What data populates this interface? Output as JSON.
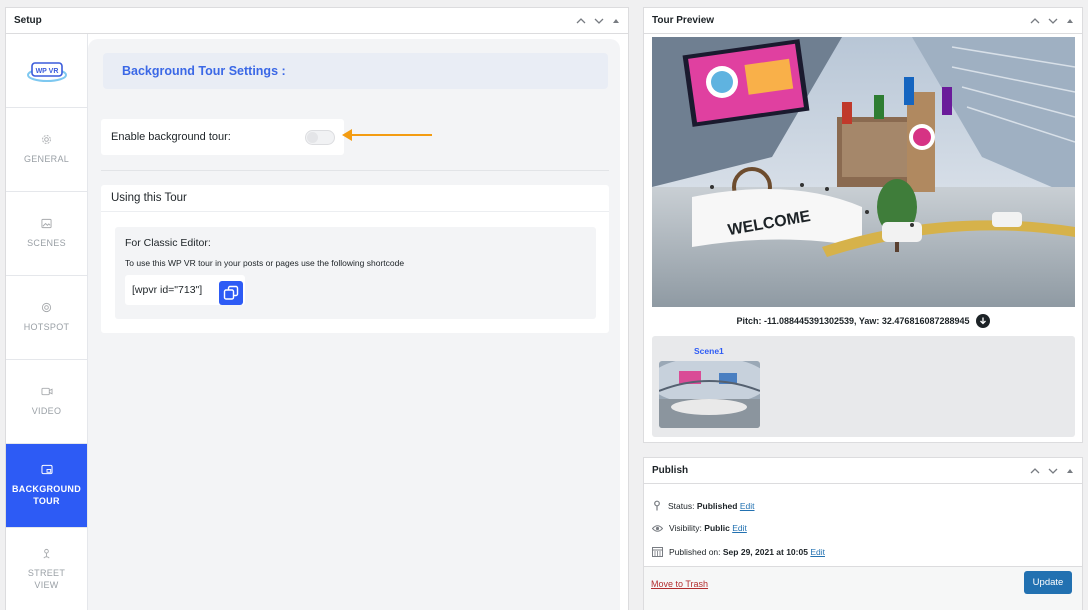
{
  "setup_panel": {
    "title": "Setup",
    "logo_text": "WP VR",
    "nav": [
      {
        "label": "GENERAL",
        "icon": "gear-icon"
      },
      {
        "label": "SCENES",
        "icon": "image-icon"
      },
      {
        "label": "HOTSPOT",
        "icon": "target-icon"
      },
      {
        "label": "VIDEO",
        "icon": "video-icon"
      },
      {
        "label": "BACKGROUND TOUR",
        "icon": "background-icon",
        "active": true
      },
      {
        "label": "STREET VIEW",
        "icon": "pegman-icon"
      }
    ],
    "section_heading": "Background Tour Settings :",
    "enable_label": "Enable background tour:",
    "enable_value": false,
    "using_title": "Using this Tour",
    "classic_title": "For Classic Editor:",
    "classic_desc": "To use this WP VR tour in your posts or pages use the following shortcode",
    "shortcode": "[wpvr id=\"713\"]"
  },
  "preview_panel": {
    "title": "Tour Preview",
    "pitch_yaw": "Pitch: -11.088445391302539, Yaw: 32.476816087288945",
    "welcome_sign": "WELCOME",
    "scene_label": "Scene1"
  },
  "publish_panel": {
    "title": "Publish",
    "status_label": "Status:",
    "status_value": "Published",
    "visibility_label": "Visibility:",
    "visibility_value": "Public",
    "published_label": "Published on:",
    "published_value": "Sep 29, 2021 at 10:05",
    "edit_link": "Edit",
    "trash_link": "Move to Trash",
    "update_button": "Update"
  },
  "colors": {
    "accent": "#2d5bf5",
    "wp_blue": "#2271b1",
    "arrow": "#f39c12",
    "trash": "#b32d2e"
  }
}
